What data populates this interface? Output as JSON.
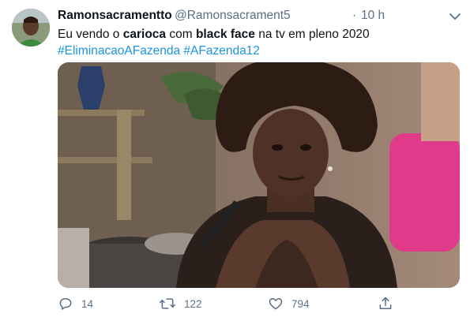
{
  "tweet": {
    "display_name": "Ramonsacramentto",
    "handle": "@Ramonsacrament5",
    "separator": "·",
    "timestamp": "10 h",
    "text_parts": {
      "p1": "Eu vendo o ",
      "b1": "carioca",
      "p2": " com ",
      "b2": "black face",
      "p3": " na tv em pleno 2020"
    },
    "hashtags": [
      "#EliminacaoAFazenda",
      "#AFazenda12"
    ]
  },
  "actions": {
    "reply_count": "14",
    "retweet_count": "122",
    "like_count": "794"
  },
  "icons": {
    "more": "chevron-down-icon",
    "reply": "reply-icon",
    "retweet": "retweet-icon",
    "like": "heart-icon",
    "share": "share-icon"
  },
  "colors": {
    "text": "#0f1419",
    "secondary": "#5b7083",
    "link": "#1b95e0"
  }
}
